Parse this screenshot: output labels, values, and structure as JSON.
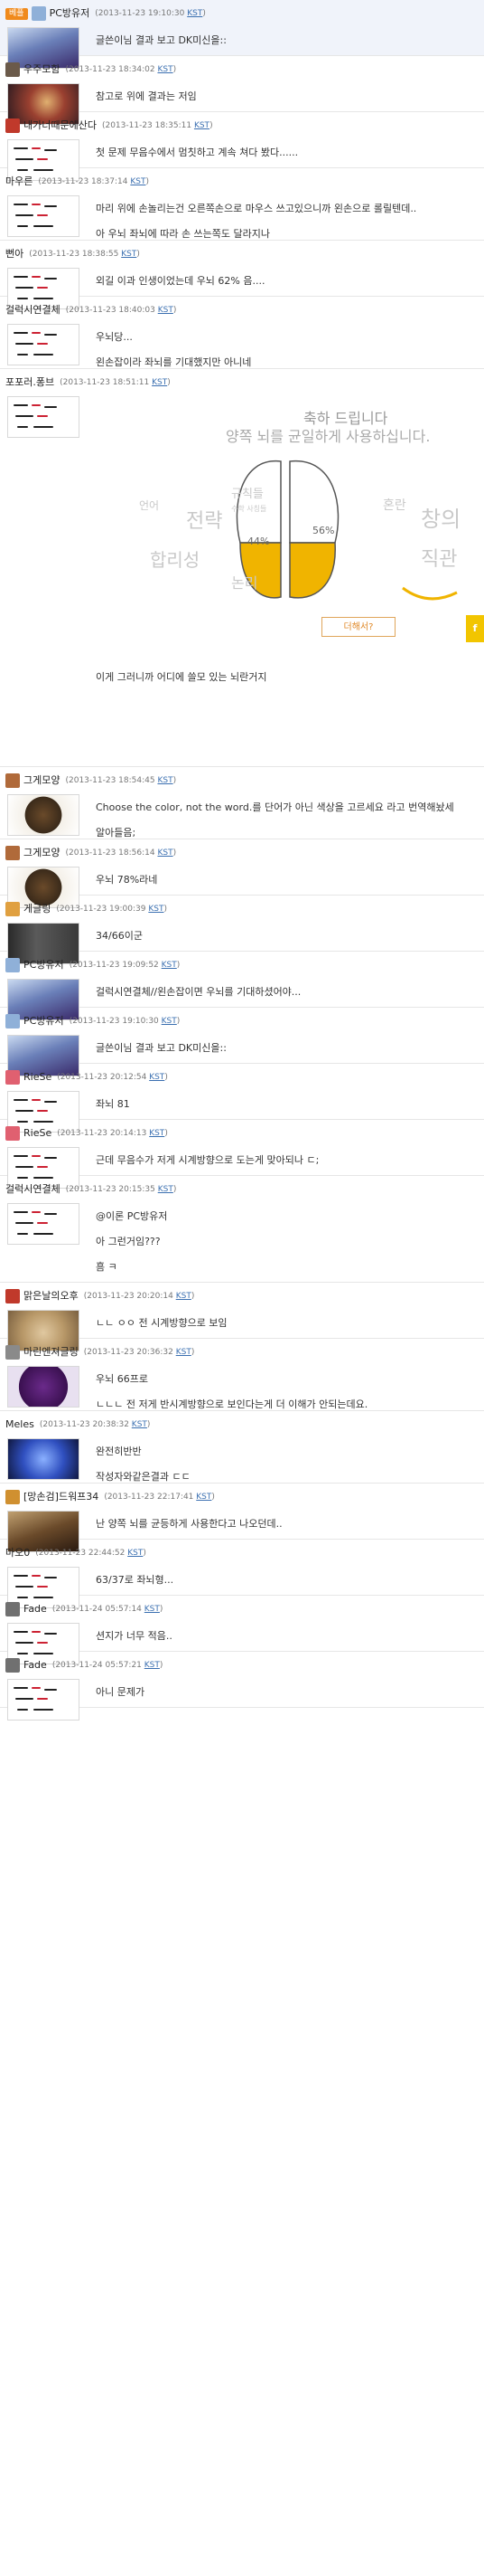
{
  "comments": [
    {
      "best": true,
      "badge": "베플",
      "nick": "PC방유저",
      "ts": "(2013-11-23 19:10:30 ",
      "kst": "KST",
      "tsEnd": ")",
      "icon": "#8fb0d8",
      "avatar": "pc",
      "lines": [
        "글쓴이님 결과 보고 DK미신을::"
      ]
    },
    {
      "nick": "우주모함",
      "ts": "(2013-11-23 18:34:02 ",
      "kst": "KST",
      "tsEnd": ")",
      "icon": "#6b5a4a",
      "avatar": "fantasy",
      "lines": [
        "참고로 위에 결과는 저임"
      ]
    },
    {
      "nick": "내가너때문에산다",
      "ts": "(2013-11-23 18:35:11 ",
      "kst": "KST",
      "tsEnd": ")",
      "icon": "#c0392b",
      "avatar": "hand",
      "lines": [
        "첫 문제 무음수에서 멈칫하고 계속 쳐다 봤다......"
      ]
    },
    {
      "nick": "마우른",
      "ts": "(2013-11-23 18:37:14 ",
      "kst": "KST",
      "tsEnd": ")",
      "icon": "",
      "avatar": "hand",
      "lines": [
        "마리 위에 손놀리는건 오른쪽손으로 마우스 쓰고있으니까 왼손으로 롤릴텐데..",
        "아 우뇌 좌뇌에 따라 손 쓰는쪽도 달라지나"
      ]
    },
    {
      "nick": "뻔아",
      "ts": "(2013-11-23 18:38:55 ",
      "kst": "KST",
      "tsEnd": ")",
      "icon": "",
      "avatar": "hand",
      "lines": [
        "외길 이과 인생이었는데 우뇌 62% 음...."
      ]
    },
    {
      "nick": "걸럭시연결체",
      "ts": "(2013-11-23 18:40:03 ",
      "kst": "KST",
      "tsEnd": ")",
      "icon": "",
      "avatar": "hand",
      "lines": [
        "우뇌당...",
        "왼손잡이라 좌뇌를 기대했지만 아니네"
      ]
    },
    {
      "nick": "포포러.퐁브",
      "ts": "(2013-11-23 18:51:11 ",
      "kst": "KST",
      "tsEnd": ")",
      "icon": "",
      "avatar": "hand",
      "lines": [
        "이게 그러니까 어디에 쓸모 있는 뇌란거지"
      ],
      "brain": true
    },
    {
      "nick": "그게모양",
      "ts": "(2013-11-23 18:54:45 ",
      "kst": "KST",
      "tsEnd": ")",
      "icon": "#b06a3a",
      "avatar": "emblem",
      "lines": [
        "Choose the color, not the word.를 단어가 아닌 색상을 고르세요 라고 번역해놨세",
        "알아들음;"
      ]
    },
    {
      "nick": "그게모양",
      "ts": "(2013-11-23 18:56:14 ",
      "kst": "KST",
      "tsEnd": ")",
      "icon": "#b06a3a",
      "avatar": "emblem",
      "lines": [
        "우뇌 78%라네"
      ]
    },
    {
      "nick": "게글링",
      "ts": "(2013-11-23 19:00:39 ",
      "kst": "KST",
      "tsEnd": ")",
      "icon": "#e0a040",
      "avatar": "dark",
      "lines": [
        "34/66이군"
      ]
    },
    {
      "nick": "PC방유저",
      "ts": "(2013-11-23 19:09:52 ",
      "kst": "KST",
      "tsEnd": ")",
      "icon": "#8fb0d8",
      "avatar": "pc",
      "lines": [
        "걸럭시연결체//왼손잡이면 우뇌를 기대하셨어야..."
      ]
    },
    {
      "nick": "PC방유저",
      "ts": "(2013-11-23 19:10:30 ",
      "kst": "KST",
      "tsEnd": ")",
      "icon": "#8fb0d8",
      "avatar": "pc",
      "lines": [
        "글쓴이님 결과 보고 DK미신을::"
      ]
    },
    {
      "nick": "RieSe",
      "ts": "(2013-11-23 20:12:54 ",
      "kst": "KST",
      "tsEnd": ")",
      "icon": "#e06070",
      "avatar": "hand",
      "lines": [
        "좌뇌 81"
      ]
    },
    {
      "nick": "RieSe",
      "ts": "(2013-11-23 20:14:13 ",
      "kst": "KST",
      "tsEnd": ")",
      "icon": "#e06070",
      "avatar": "hand",
      "lines": [
        "근데 무음수가 저게 시계방향으로 도는게 맞아되나 ㄷ;"
      ]
    },
    {
      "nick": "걸럭시연결체",
      "ts": "(2013-11-23 20:15:35 ",
      "kst": "KST",
      "tsEnd": ")",
      "icon": "",
      "avatar": "hand",
      "lines": [
        "@이론 PC방유저",
        "아 그런거임???",
        "흠 ㅋ"
      ]
    },
    {
      "nick": "맑은날의오후",
      "ts": "(2013-11-23 20:20:14 ",
      "kst": "KST",
      "tsEnd": ")",
      "icon": "#c0392b",
      "avatar": "cat",
      "lines": [
        "ㄴㄴ ㅇㅇ 전 시계방향으로 보임"
      ]
    },
    {
      "nick": "마린엔져글링",
      "ts": "(2013-11-23 20:36:32 ",
      "kst": "KST",
      "tsEnd": ")",
      "icon": "#8a8a8a",
      "avatar": "purple",
      "lines": [
        "우뇌 66프로",
        "ㄴㄴㄴ 전 저게 반시계방향으로 보인다는게 더 이해가 안되는데요."
      ]
    },
    {
      "nick": "Meles",
      "ts": "(2013-11-23 20:38:32 ",
      "kst": "KST",
      "tsEnd": ")",
      "icon": "",
      "avatar": "blue",
      "lines": [
        "완전히반반",
        "작성자와같은결과 ㄷㄷ"
      ]
    },
    {
      "nick": "[망손검]드워프34",
      "ts": "(2013-11-23 22:17:41 ",
      "kst": "KST",
      "tsEnd": ")",
      "icon": "#d09030",
      "avatar": "warrior",
      "lines": [
        "난 양쪽 뇌를 균등하게 사용한다고 나오던데.."
      ]
    },
    {
      "nick": "마오0",
      "ts": "(2013-11-23 22:44:52 ",
      "kst": "KST",
      "tsEnd": ")",
      "icon": "",
      "avatar": "hand",
      "lines": [
        "63/37로 좌뇌형..."
      ]
    },
    {
      "nick": "Fade",
      "ts": "(2013-11-24 05:57:14 ",
      "kst": "KST",
      "tsEnd": ")",
      "icon": "#707070",
      "avatar": "hand",
      "lines": [
        "션지가 너무 적음.."
      ]
    },
    {
      "nick": "Fade",
      "ts": "(2013-11-24 05:57:21 ",
      "kst": "KST",
      "tsEnd": ")",
      "icon": "#707070",
      "avatar": "hand",
      "lines": [
        "아니 문제가"
      ]
    }
  ],
  "brain": {
    "heading1": "축하 드립니다",
    "heading2": "양쪽 뇌를 균일하게 사용하십니다.",
    "leftPercent": "44%",
    "rightPercent": "56%",
    "button": "더해서?",
    "fbTab": "f",
    "words": [
      "규칙들",
      "언어",
      "전략",
      "합리성",
      "논리",
      "혼란",
      "창의",
      "직관",
      "수학 사칭들"
    ]
  }
}
